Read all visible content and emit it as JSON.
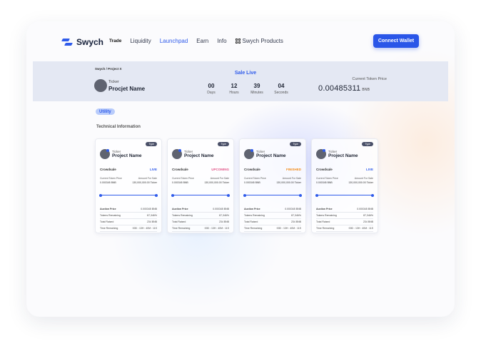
{
  "nav": {
    "logo": "Swych",
    "items": [
      {
        "label": "Trade",
        "cls": "trade"
      },
      {
        "label": "Liquidity",
        "cls": ""
      },
      {
        "label": "Launchpad",
        "cls": "active"
      },
      {
        "label": "Earn",
        "cls": ""
      },
      {
        "label": "Info",
        "cls": ""
      }
    ],
    "products": "Swych Products",
    "connect": "Connect Wallet"
  },
  "sale": {
    "breadcrumb": "Swych / Project X",
    "ticker": "Ticker",
    "project_name": "Procjet Name",
    "status": "Sale Live",
    "countdown": [
      {
        "value": "00",
        "label": "Days"
      },
      {
        "value": "12",
        "label": "Hours"
      },
      {
        "value": "39",
        "label": "Minutes"
      },
      {
        "value": "04",
        "label": "Seconds"
      }
    ],
    "price_label": "Current Token Price",
    "price_value": "0.00485311",
    "price_unit": "BNB"
  },
  "utility": "Utility",
  "technical": "Technical Information",
  "colors": {
    "accent": "#2f5bea",
    "live": "#2f5bea",
    "upcoming": "#e2588a",
    "finished": "#f28c1b"
  },
  "cards": [
    {
      "type": "Type",
      "ticker": "Ticker",
      "name": "Project Name",
      "crowdsale": "Crowdsale",
      "status": "LIVE",
      "status_color": "#2f5bea",
      "price_label": "Current Token Price",
      "amount_label": "Amount For Sale",
      "price_value": "0.000345 BNB",
      "amount_value": "130,000,000.00 Ticker",
      "info": [
        [
          "Auction Price",
          "0.000345 BNB"
        ],
        [
          "Tokens Remaining",
          "87,346%"
        ],
        [
          "Total Raised",
          "234 BNB"
        ],
        [
          "Time Remaining",
          "00D : 13H : 40M : 11S"
        ]
      ]
    },
    {
      "type": "Type",
      "ticker": "Ticker",
      "name": "Project Name",
      "crowdsale": "Crowdsale",
      "status": "UPCOMING",
      "status_color": "#e2588a",
      "price_label": "Current Token Price",
      "amount_label": "Amount For Sale",
      "price_value": "0.000345 BNB",
      "amount_value": "130,000,000.00 Ticker",
      "info": [
        [
          "Auction Price",
          "0.000345 BNB"
        ],
        [
          "Tokens Remaining",
          "87,346%"
        ],
        [
          "Total Raised",
          "234 BNB"
        ],
        [
          "Time Remaining",
          "00D : 13H : 40M : 11S"
        ]
      ]
    },
    {
      "type": "Type",
      "ticker": "Ticker",
      "name": "Project Name",
      "crowdsale": "Crowdsale",
      "status": "FINISHED",
      "status_color": "#f28c1b",
      "price_label": "Current Token Price",
      "amount_label": "Amount For Sale",
      "price_value": "0.000345 BNB",
      "amount_value": "130,000,000.00 Ticker",
      "info": [
        [
          "Auction Price",
          "0.000345 BNB"
        ],
        [
          "Tokens Remaining",
          "87,346%"
        ],
        [
          "Total Raised",
          "234 BNB"
        ],
        [
          "Time Remaining",
          "00D : 13H : 40M : 11S"
        ]
      ]
    },
    {
      "type": "Type",
      "ticker": "Ticker",
      "name": "Project Name",
      "crowdsale": "Crowdsale",
      "status": "LIVE",
      "status_color": "#2f5bea",
      "price_label": "Current Token Price",
      "amount_label": "Amount For Sale",
      "price_value": "0.000345 BNB",
      "amount_value": "130,000,000.00 Ticker",
      "info": [
        [
          "Auction Price",
          "0.000345 BNB"
        ],
        [
          "Tokens Remaining",
          "87,346%"
        ],
        [
          "Total Raised",
          "234 BNB"
        ],
        [
          "Time Remaining",
          "00D : 13H : 40M : 11S"
        ]
      ]
    }
  ]
}
